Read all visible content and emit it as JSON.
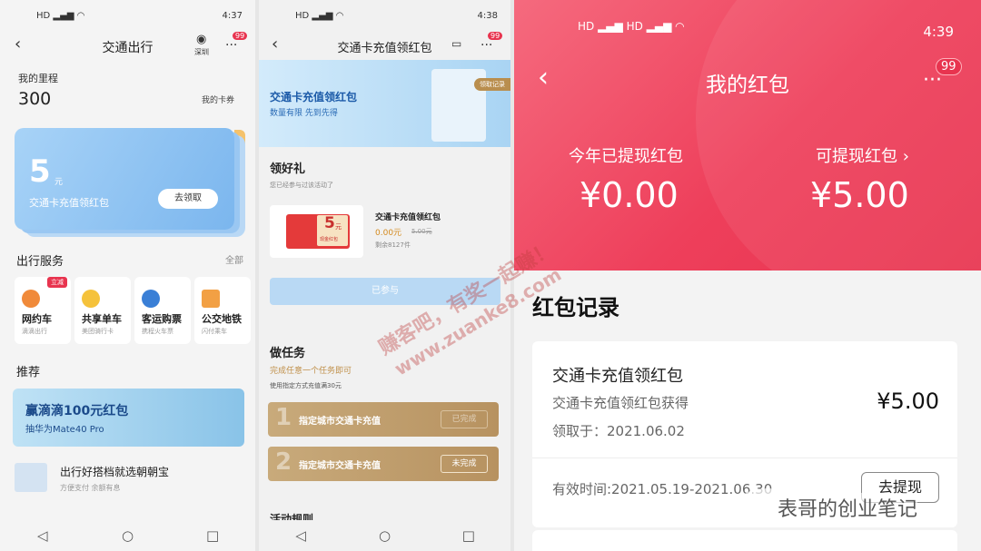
{
  "colors": {
    "accent_red": "#e8344f",
    "card_blue": "#7bb6ee",
    "gold": "#b79260"
  },
  "watermark": {
    "line1": "赚客吧，有奖一起赚！",
    "line2": "www.zuanke8.com"
  },
  "footer_credit": "表哥的创业笔记",
  "p1": {
    "status_time": "4:37",
    "nav": {
      "back_icon": "back-icon",
      "title": "交通出行",
      "city": "深圳",
      "badge": "99"
    },
    "mileage": {
      "label": "我的里程",
      "value": "300",
      "card_link": "我的卡券"
    },
    "card": {
      "amount": "5",
      "unit": "元",
      "desc": "交通卡充值领红包",
      "button": "去领取"
    },
    "services": {
      "title": "出行服务",
      "all": "全部",
      "items": [
        {
          "label": "网约车",
          "sub": "滴滴出行",
          "tag": "立减",
          "icon": "didi-icon",
          "color": "#f08a3a"
        },
        {
          "label": "共享单车",
          "sub": "美团骑行卡",
          "tag": "",
          "icon": "bike-icon",
          "color": "#f5c23b"
        },
        {
          "label": "客运购票",
          "sub": "携程火车票",
          "tag": "",
          "icon": "ticket-icon",
          "color": "#3a7fd6"
        },
        {
          "label": "公交地铁",
          "sub": "闪付乘车",
          "tag": "",
          "icon": "metro-icon",
          "color": "#f2a044"
        }
      ]
    },
    "recommend": {
      "title": "推荐",
      "banner_title": "赢滴滴100元红包",
      "banner_sub": "抽华为Mate40 Pro"
    },
    "list_item": {
      "title": "出行好搭档就选朝朝宝",
      "sub": "方便支付 余额有息"
    }
  },
  "p2": {
    "status_time": "4:38",
    "nav": {
      "title": "交通卡充值领红包",
      "badge": "99"
    },
    "hero": {
      "title": "交通卡充值领红包",
      "sub": "数量有限 先到先得",
      "link": "领取记录"
    },
    "gift": {
      "section": "领好礼",
      "joined": "您已经参与过该活动了",
      "coupon_amount": "5",
      "coupon_unit": "元",
      "coupon_tag": "现金红包",
      "name": "交通卡充值领红包",
      "price": "0.00元",
      "original": "5.00元",
      "remain": "剩余8127件",
      "button": "已参与"
    },
    "tasks": {
      "section": "做任务",
      "hint": "完成任意一个任务即可",
      "note": "使用指定方式充值满30元",
      "items": [
        {
          "num": "1",
          "label": "指定城市交通卡充值",
          "status": "已完成"
        },
        {
          "num": "2",
          "label": "指定城市交通卡充值",
          "status": "未完成"
        }
      ]
    },
    "rules_peek": "活动规则"
  },
  "p3": {
    "status_time": "4:39",
    "nav": {
      "title": "我的红包",
      "badge": "99"
    },
    "withdrawn": {
      "label": "今年已提现红包",
      "value": "¥0.00"
    },
    "available": {
      "label": "可提现红包",
      "value": "¥5.00"
    },
    "records": {
      "title": "红包记录",
      "item": {
        "name": "交通卡充值领红包",
        "source": "交通卡充值领红包获得",
        "date": "领取于：2021.06.02",
        "amount": "¥5.00",
        "valid": "有效时间:2021.05.19-2021.06.30",
        "button": "去提现"
      }
    }
  }
}
